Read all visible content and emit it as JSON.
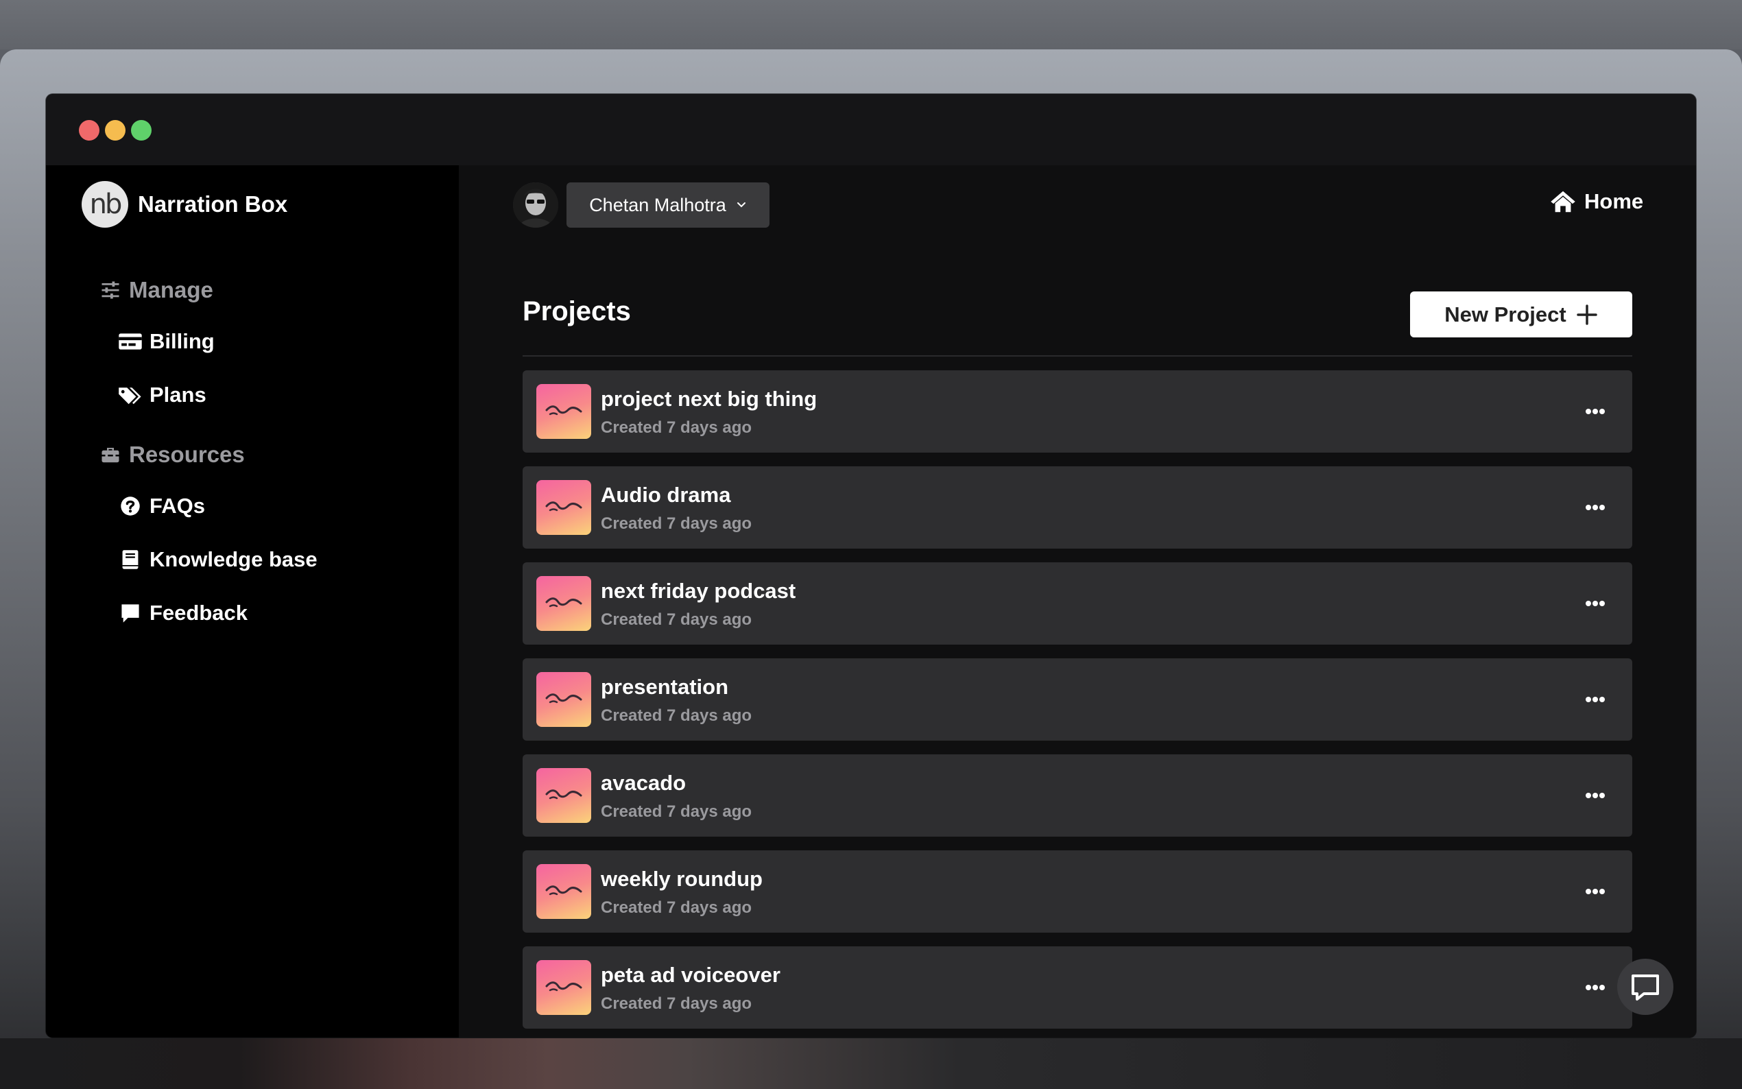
{
  "app": {
    "brand_logo_text": "nb",
    "brand_name": "Narration Box"
  },
  "sidebar": {
    "sections": [
      {
        "label": "Manage",
        "icon": "sliders-icon"
      },
      {
        "label": "Resources",
        "icon": "toolbox-icon"
      }
    ],
    "items": [
      {
        "label": "Billing",
        "icon": "credit-card-icon"
      },
      {
        "label": "Plans",
        "icon": "tags-icon"
      },
      {
        "label": "FAQs",
        "icon": "question-circle-icon"
      },
      {
        "label": "Knowledge base",
        "icon": "book-icon"
      },
      {
        "label": "Feedback",
        "icon": "comment-icon"
      }
    ]
  },
  "header": {
    "user_name": "Chetan Malhotra",
    "home_label": "Home"
  },
  "projects": {
    "title": "Projects",
    "new_button_label": "New Project",
    "items": [
      {
        "name": "project next big thing",
        "meta": "Created 7 days ago"
      },
      {
        "name": "Audio drama",
        "meta": "Created 7 days ago"
      },
      {
        "name": "next friday podcast",
        "meta": "Created 7 days ago"
      },
      {
        "name": "presentation",
        "meta": "Created 7 days ago"
      },
      {
        "name": "avacado",
        "meta": "Created 7 days ago"
      },
      {
        "name": "weekly roundup",
        "meta": "Created 7 days ago"
      },
      {
        "name": "peta ad voiceover",
        "meta": "Created 7 days ago"
      }
    ]
  },
  "colors": {
    "window_bg": "#0f0f10",
    "sidebar_bg": "#000000",
    "row_bg": "#2e2e30",
    "thumb_gradient_start": "#f564a0",
    "thumb_gradient_end": "#fbd37a"
  }
}
